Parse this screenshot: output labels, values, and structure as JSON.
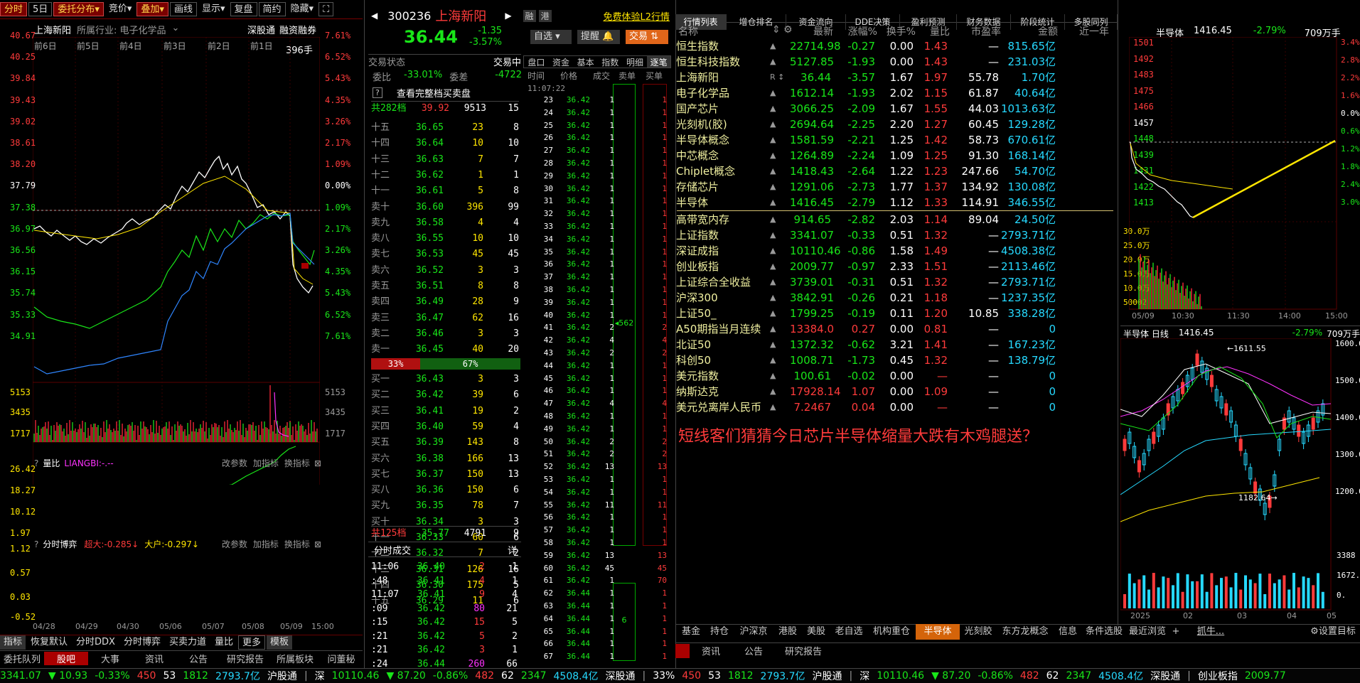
{
  "topbar": {
    "tabs": [
      "分时",
      "5日",
      "委托分布",
      "竞价",
      "叠加",
      "画线",
      "显示",
      "复盘",
      "简约",
      "隐藏"
    ]
  },
  "left": {
    "stock": "上海新阳",
    "industry": "所属行业: 电子化学品",
    "tags": [
      "深股通",
      "融资融券"
    ],
    "days": [
      "前6日",
      "前5日",
      "前4日",
      "前3日",
      "前2日",
      "前1日"
    ],
    "vol_tag": "396手",
    "price_ticks": [
      "40.67",
      "40.25",
      "39.84",
      "39.43",
      "39.02",
      "38.61",
      "38.20",
      "37.79",
      "37.38",
      "36.97",
      "36.56",
      "36.15",
      "35.74",
      "35.33",
      "34.91"
    ],
    "pct_ticks": [
      "7.61%",
      "6.52%",
      "5.43%",
      "4.35%",
      "3.26%",
      "2.17%",
      "1.09%",
      "0.00%",
      "1.09%",
      "2.17%",
      "3.26%",
      "4.35%",
      "5.43%",
      "6.52%",
      "7.61%"
    ],
    "vol_ticks": [
      "5153",
      "3435",
      "1717"
    ],
    "liangbi": {
      "label": "量比",
      "name": "LIANGBI:-.--",
      "btns": [
        "改参数",
        "加指标",
        "换指标"
      ],
      "ticks": [
        "26.42",
        "18.27",
        "10.12",
        "1.97"
      ]
    },
    "boyi": {
      "label": "分时博弈",
      "a": "超大:-0.285↓",
      "b": "大户:-0.297↓",
      "btns": [
        "改参数",
        "加指标",
        "换指标"
      ],
      "ticks": [
        "1.12",
        "0.57",
        "0.03",
        "-0.52"
      ]
    },
    "dates": [
      "04/28",
      "04/29",
      "04/30",
      "05/06",
      "05/07",
      "05/08",
      "05/09",
      "15:00"
    ],
    "bottom_tabs": [
      "指标",
      "恢复默认",
      "分时DDX",
      "分时博弈",
      "买卖力道",
      "量比",
      "更多",
      "模板"
    ],
    "bottom2": [
      "委托队列",
      "股吧",
      "大事",
      "资讯",
      "公告",
      "研究报告",
      "所属板块",
      "问董秘"
    ]
  },
  "ob": {
    "code": "300236",
    "name": "上海新阳",
    "promo": "免费体验L2行情",
    "badges": [
      "融",
      "港"
    ],
    "price": "36.44",
    "chg": "-1.35",
    "pct": "-3.57%",
    "btns": [
      "自选",
      "提醒",
      "交易"
    ],
    "state": "交易状态",
    "state_val": "交易中",
    "wb_label": "委比",
    "wb": "-33.01%",
    "wc_label": "委差",
    "wc": "-4722",
    "view": "查看完整档买卖盘",
    "sell_total": [
      "共282档",
      "39.92",
      "9513",
      "15"
    ],
    "sells": [
      [
        "十五",
        "36.65",
        "23",
        "8"
      ],
      [
        "十四",
        "36.64",
        "10",
        "10"
      ],
      [
        "十三",
        "36.63",
        "7",
        "7"
      ],
      [
        "十二",
        "36.62",
        "1",
        "1"
      ],
      [
        "十一",
        "36.61",
        "5",
        "8"
      ],
      [
        "卖十",
        "36.60",
        "396",
        "99"
      ],
      [
        "卖九",
        "36.58",
        "4",
        "4"
      ],
      [
        "卖八",
        "36.55",
        "10",
        "10"
      ],
      [
        "卖七",
        "36.53",
        "45",
        "45"
      ],
      [
        "卖六",
        "36.52",
        "3",
        "3"
      ],
      [
        "卖五",
        "36.51",
        "8",
        "8"
      ],
      [
        "卖四",
        "36.49",
        "28",
        "9"
      ],
      [
        "卖三",
        "36.47",
        "62",
        "16"
      ],
      [
        "卖二",
        "36.46",
        "3",
        "3"
      ],
      [
        "卖一",
        "36.45",
        "40",
        "20"
      ]
    ],
    "bar": [
      "33%",
      "67%"
    ],
    "buys": [
      [
        "买一",
        "36.43",
        "3",
        "3"
      ],
      [
        "买二",
        "36.42",
        "39",
        "6"
      ],
      [
        "买三",
        "36.41",
        "19",
        "2"
      ],
      [
        "买四",
        "36.40",
        "59",
        "4"
      ],
      [
        "买五",
        "36.39",
        "143",
        "8"
      ],
      [
        "买六",
        "36.38",
        "166",
        "13"
      ],
      [
        "买七",
        "36.37",
        "150",
        "13"
      ],
      [
        "买八",
        "36.36",
        "150",
        "6"
      ],
      [
        "买九",
        "36.35",
        "78",
        "7"
      ],
      [
        "买十",
        "36.34",
        "3",
        "3"
      ],
      [
        "十一",
        "36.33",
        "60",
        "6"
      ],
      [
        "十二",
        "36.32",
        "7",
        "2"
      ],
      [
        "十三",
        "36.31",
        "126",
        "16"
      ],
      [
        "十四",
        "36.30",
        "175",
        "5"
      ],
      [
        "十五",
        "36.29",
        "11",
        "6"
      ]
    ],
    "buy_total": [
      "共125档",
      "35.77",
      "4791",
      "9"
    ],
    "ticks_title": "分时成交",
    "ticks_detail": "详",
    "ticks": [
      [
        "11:06",
        "36.40",
        "2",
        "1"
      ],
      [
        ":48",
        "36.41",
        "4",
        "1"
      ],
      [
        "11:07",
        "36.41",
        "9",
        "4"
      ],
      [
        ":09",
        "36.42",
        "80",
        "21"
      ],
      [
        ":15",
        "36.42",
        "15",
        "5"
      ],
      [
        ":21",
        "36.42",
        "5",
        "2"
      ],
      [
        ":21",
        "36.42",
        "3",
        "1"
      ],
      [
        ":24",
        "36.44",
        "260",
        "66"
      ]
    ]
  },
  "mid": {
    "tabs": [
      "盘口",
      "资金",
      "基本",
      "指数",
      "明细",
      "逐笔"
    ],
    "head": [
      "时间",
      "价格",
      "成交",
      "卖单",
      "买单"
    ],
    "first_time": "11:07:22",
    "rows": [
      [
        "23",
        "36.42",
        "1",
        "1"
      ],
      [
        "24",
        "36.42",
        "1",
        "1"
      ],
      [
        "25",
        "36.42",
        "1",
        "1"
      ],
      [
        "26",
        "36.42",
        "1",
        "1"
      ],
      [
        "27",
        "36.42",
        "1",
        "1"
      ],
      [
        "28",
        "36.42",
        "1",
        "1"
      ],
      [
        "29",
        "36.42",
        "1",
        "1"
      ],
      [
        "30",
        "36.42",
        "1",
        "1"
      ],
      [
        "31",
        "36.42",
        "1",
        "1"
      ],
      [
        "32",
        "36.42",
        "1",
        "1"
      ],
      [
        "33",
        "36.42",
        "1",
        "1"
      ],
      [
        "34",
        "36.42",
        "1",
        "1"
      ],
      [
        "35",
        "36.42",
        "1",
        "1"
      ],
      [
        "36",
        "36.42",
        "1",
        "1"
      ],
      [
        "37",
        "36.42",
        "1",
        "1"
      ],
      [
        "38",
        "36.42",
        "1",
        "1"
      ],
      [
        "39",
        "36.42",
        "1",
        "1"
      ],
      [
        "40",
        "36.42",
        "1",
        "1"
      ],
      [
        "41",
        "36.42",
        "2",
        "2"
      ],
      [
        "42",
        "36.42",
        "4",
        "4"
      ],
      [
        "43",
        "36.42",
        "2",
        "2"
      ],
      [
        "44",
        "36.42",
        "1",
        "1"
      ],
      [
        "45",
        "36.42",
        "1",
        "1"
      ],
      [
        "46",
        "36.42",
        "1",
        "1"
      ],
      [
        "47",
        "36.42",
        "4",
        "4"
      ],
      [
        "48",
        "36.42",
        "1",
        "1"
      ],
      [
        "49",
        "36.42",
        "1",
        "1"
      ],
      [
        "50",
        "36.42",
        "2",
        "2"
      ],
      [
        "51",
        "36.42",
        "2",
        "2"
      ],
      [
        "52",
        "36.42",
        "13",
        "13"
      ],
      [
        "53",
        "36.42",
        "1",
        "1"
      ],
      [
        "54",
        "36.42",
        "1",
        "1"
      ],
      [
        "55",
        "36.42",
        "11",
        "11"
      ],
      [
        "56",
        "36.42",
        "1",
        "1"
      ],
      [
        "57",
        "36.42",
        "1",
        "1"
      ],
      [
        "58",
        "36.42",
        "1",
        "1"
      ],
      [
        "59",
        "36.42",
        "13",
        "13"
      ],
      [
        "60",
        "36.42",
        "45",
        "45"
      ],
      [
        "61",
        "36.42",
        "1",
        "70"
      ],
      [
        "62",
        "36.44",
        "1",
        "1"
      ],
      [
        "63",
        "36.44",
        "1",
        "1"
      ],
      [
        "64",
        "36.44",
        "1",
        "1"
      ],
      [
        "65",
        "36.44",
        "1",
        "1"
      ],
      [
        "66",
        "36.44",
        "1",
        "1"
      ],
      [
        "67",
        "36.44",
        "1",
        "1"
      ]
    ],
    "big1": "562",
    "big2": "6",
    "big3": "1",
    "big4": "70"
  },
  "quotes": {
    "tabs": [
      "行情列表",
      "增仓排名",
      "资金流向",
      "DDE决策",
      "盈利预测",
      "财务数据",
      "阶段统计",
      "多股同列"
    ],
    "head": [
      "名称",
      "最新",
      "涨幅%",
      "换手%",
      "量比",
      "市盈率",
      "金额",
      "近一年"
    ],
    "rows": [
      [
        "恒生指数",
        "22714.98",
        "-0.27",
        "0.00",
        "1.43",
        "—",
        "815.65亿"
      ],
      [
        "恒生科技指数",
        "5127.85",
        "-1.93",
        "0.00",
        "1.43",
        "—",
        "231.03亿"
      ],
      [
        "上海新阳",
        "36.44",
        "-3.57",
        "1.67",
        "1.97",
        "55.78",
        "1.70亿"
      ],
      [
        "电子化学品",
        "1612.14",
        "-1.93",
        "2.02",
        "1.15",
        "61.87",
        "40.64亿"
      ],
      [
        "国产芯片",
        "3066.25",
        "-2.09",
        "1.67",
        "1.55",
        "44.03",
        "1013.63亿"
      ],
      [
        "光刻机(胶)",
        "2694.64",
        "-2.25",
        "2.20",
        "1.27",
        "60.45",
        "129.28亿"
      ],
      [
        "半导体概念",
        "1581.59",
        "-2.21",
        "1.25",
        "1.42",
        "58.73",
        "670.61亿"
      ],
      [
        "中芯概念",
        "1264.89",
        "-2.24",
        "1.09",
        "1.25",
        "91.30",
        "168.14亿"
      ],
      [
        "Chiplet概念",
        "1418.43",
        "-2.64",
        "1.22",
        "1.23",
        "247.66",
        "54.70亿"
      ],
      [
        "存储芯片",
        "1291.06",
        "-2.73",
        "1.77",
        "1.37",
        "134.92",
        "130.08亿"
      ],
      [
        "半导体",
        "1416.45",
        "-2.79",
        "1.12",
        "1.33",
        "114.91",
        "346.55亿"
      ],
      [
        "高带宽内存",
        "914.65",
        "-2.82",
        "2.03",
        "1.14",
        "89.04",
        "24.50亿"
      ],
      [
        "上证指数",
        "3341.07",
        "-0.33",
        "0.51",
        "1.32",
        "—",
        "2793.71亿"
      ],
      [
        "深证成指",
        "10110.46",
        "-0.86",
        "1.58",
        "1.49",
        "—",
        "4508.38亿"
      ],
      [
        "创业板指",
        "2009.77",
        "-0.97",
        "2.33",
        "1.51",
        "—",
        "2113.46亿"
      ],
      [
        "上证综合全收益",
        "3739.01",
        "-0.31",
        "0.51",
        "1.32",
        "—",
        "2793.71亿"
      ],
      [
        "沪深300",
        "3842.91",
        "-0.26",
        "0.21",
        "1.18",
        "—",
        "1237.35亿"
      ],
      [
        "上证50_",
        "1799.25",
        "-0.19",
        "0.11",
        "1.20",
        "10.85",
        "338.28亿"
      ],
      [
        "A50期指当月连续",
        "13384.0",
        "0.27",
        "0.00",
        "0.81",
        "—",
        "0"
      ],
      [
        "北证50",
        "1372.32",
        "-0.62",
        "3.21",
        "1.41",
        "—",
        "167.23亿"
      ],
      [
        "科创50",
        "1008.71",
        "-1.73",
        "0.45",
        "1.32",
        "—",
        "138.79亿"
      ],
      [
        "美元指数",
        "100.61",
        "-0.02",
        "0.00",
        "—",
        "—",
        "0"
      ],
      [
        "纳斯达克",
        "17928.14",
        "1.07",
        "0.00",
        "1.09",
        "—",
        "0"
      ],
      [
        "美元兑离岸人民币",
        "7.2467",
        "0.04",
        "0.00",
        "—",
        "—",
        "0"
      ]
    ],
    "banner": "短线客们猜猜今日芯片半导体缩量大跌有木鸡腿送？",
    "bottom_tabs": [
      "基金",
      "持仓",
      "沪深京",
      "港股",
      "美股",
      "老自选",
      "机构重仓",
      "半导体",
      "光刻胶",
      "东方龙概念",
      "信息",
      "条件选股",
      "最近浏览"
    ],
    "grab": "抓牛...",
    "settings": "设置目标",
    "info_tabs": [
      "资讯",
      "公告",
      "研究报告"
    ]
  },
  "right": {
    "name": "半导体",
    "price": "1416.45",
    "pct": "-2.79%",
    "vol": "709万手",
    "left_ticks": [
      "1501",
      "1492",
      "1483",
      "1475",
      "1466",
      "1457",
      "1448",
      "1439",
      "1431",
      "1422",
      "1413"
    ],
    "right_ticks": [
      "3.4%",
      "2.8%",
      "2.2%",
      "1.6%",
      "0.0%",
      "0.6%",
      "1.2%",
      "1.8%",
      "2.4%",
      "3.0%"
    ],
    "vol_ticks": [
      "30.0万",
      "25.0万",
      "20.0万",
      "15.0万",
      "10.0万",
      "50002"
    ],
    "times": [
      "05/09",
      "10:30",
      "11:30",
      "14:00",
      "15:00"
    ],
    "k_title": "半导体  日线",
    "k_price": "1416.45",
    "k_pct": "-2.79%",
    "k_vol": "709万手",
    "k_ticks": [
      "1600.0",
      "1500.0",
      "1400.0",
      "1300.0",
      "1200.0"
    ],
    "k_high": "1611.55",
    "k_low": "1182.64",
    "kv_ticks": [
      "3388",
      "1672.",
      "0."
    ],
    "k_dates": [
      "2025",
      "02",
      "03",
      "04",
      "05"
    ]
  },
  "status": {
    "a": "3341.07",
    "b": "▼ 10.93",
    "c": "-0.33%",
    "d": "450",
    "e": "53",
    "f": "1812",
    "g": "2793.7亿",
    "h": "沪股通",
    "i": "深",
    "j": "10110.46",
    "k": "▼ 87.20",
    "l": "-0.86%",
    "m": "482",
    "n": "62",
    "o": "2347",
    "p": "4508.4亿",
    "q": "深股通",
    "r": "创业板指",
    "s": "2009.77",
    "t": "33%",
    "u": "450",
    "v": "53",
    "w": "1812",
    "x": "2793.7亿",
    "y": "沪股通",
    "z": "深",
    "aa": "10110.46",
    "ab": "▼ 87.20",
    "ac": "-0.86%",
    "ad": "482",
    "ae": "62",
    "af": "2347",
    "ag": "4508.4亿",
    "ah": "深股通"
  }
}
